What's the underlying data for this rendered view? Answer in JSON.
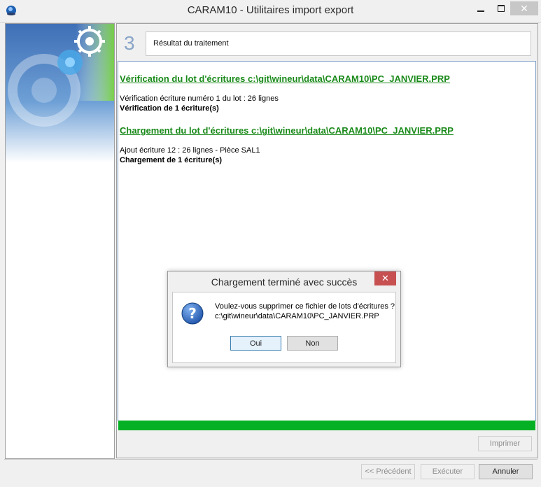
{
  "window": {
    "title": "CARAM10 - Utilitaires import export"
  },
  "titlebar": {
    "minimize_icon": "minimize-icon",
    "maximize_icon": "maximize-icon",
    "close_icon": "close-icon"
  },
  "step": {
    "number": "3",
    "title": "Résultat du traitement"
  },
  "results": {
    "heading1": "Vérification du lot d'écritures c:\\git\\wineur\\data\\CARAM10\\PC_JANVIER.PRP",
    "line1": "Vérification écriture numéro 1 du lot : 26 lignes",
    "line2": "Vérification de 1 écriture(s)",
    "heading2": "Chargement du lot d'écritures c:\\git\\wineur\\data\\CARAM10\\PC_JANVIER.PRP",
    "line3": "Ajout écriture 12 : 26 lignes - Pièce SAL1",
    "line4": "Chargement de 1 écriture(s)"
  },
  "progress": {
    "percent": 100,
    "color": "#06b025"
  },
  "buttons": {
    "print": "Imprimer",
    "previous": "<< Précédent",
    "execute": "Exécuter",
    "cancel": "Annuler"
  },
  "dialog": {
    "title": "Chargement terminé avec succès",
    "message_line1": "Voulez-vous supprimer ce fichier de lots d'écritures ?",
    "message_line2": "c:\\git\\wineur\\data\\CARAM10\\PC_JANVIER.PRP",
    "yes": "Oui",
    "no": "Non",
    "icon": "question-icon"
  },
  "colors": {
    "heading": "#1a8a1a",
    "accent": "#8aa5c8",
    "dialog_close": "#c75050"
  }
}
